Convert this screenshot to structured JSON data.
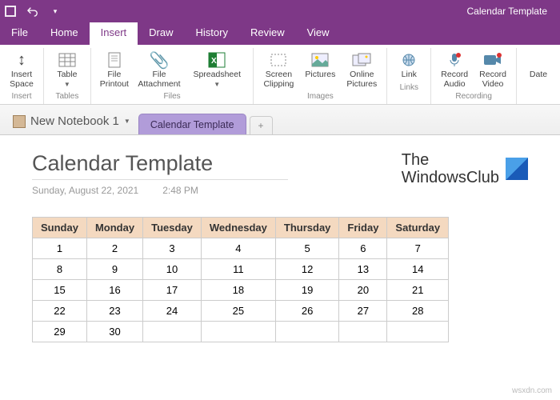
{
  "app": {
    "title": "Calendar Template"
  },
  "menu": {
    "file": "File",
    "home": "Home",
    "insert": "Insert",
    "draw": "Draw",
    "history": "History",
    "review": "Review",
    "view": "View"
  },
  "ribbon": {
    "insert_space": "Insert\nSpace",
    "table": "Table",
    "file_printout": "File\nPrintout",
    "file_attachment": "File\nAttachment",
    "spreadsheet": "Spreadsheet",
    "screen_clipping": "Screen\nClipping",
    "pictures": "Pictures",
    "online_pictures": "Online\nPictures",
    "link": "Link",
    "record_audio": "Record\nAudio",
    "record_video": "Record\nVideo",
    "date": "Date",
    "g_insert": "Insert",
    "g_tables": "Tables",
    "g_files": "Files",
    "g_images": "Images",
    "g_links": "Links",
    "g_recording": "Recording"
  },
  "section": {
    "notebook": "New Notebook 1",
    "tab": "Calendar Template"
  },
  "page": {
    "title": "Calendar Template",
    "date": "Sunday, August 22, 2021",
    "time": "2:48 PM",
    "brand1": "The",
    "brand2": "WindowsClub"
  },
  "cal": {
    "h": [
      "Sunday",
      "Monday",
      "Tuesday",
      "Wednesday",
      "Thursday",
      "Friday",
      "Saturday"
    ],
    "rows": [
      [
        "1",
        "2",
        "3",
        "4",
        "5",
        "6",
        "7"
      ],
      [
        "8",
        "9",
        "10",
        "11",
        "12",
        "13",
        "14"
      ],
      [
        "15",
        "16",
        "17",
        "18",
        "19",
        "20",
        "21"
      ],
      [
        "22",
        "23",
        "24",
        "25",
        "26",
        "27",
        "28"
      ],
      [
        "29",
        "30",
        "",
        "",
        "",
        "",
        ""
      ]
    ]
  },
  "watermark": "wsxdn.com"
}
